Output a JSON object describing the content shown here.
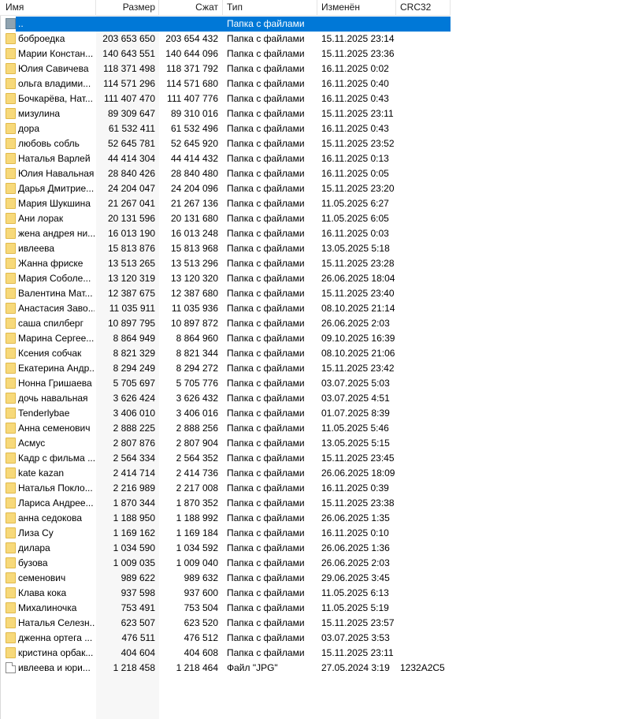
{
  "columns": {
    "name": "Имя",
    "size": "Размер",
    "compressed": "Сжат",
    "type": "Тип",
    "modified": "Изменён",
    "crc": "CRC32"
  },
  "parent_row": {
    "name": "..",
    "type": "Папка с файлами",
    "icon": "parent-folder-icon"
  },
  "rows": [
    {
      "name": "боброедка",
      "size": "203 653 650",
      "compressed": "203 654 432",
      "type": "Папка с файлами",
      "modified": "15.11.2025 23:14",
      "crc": "",
      "icon": "folder-icon"
    },
    {
      "name": "Марии Констан...",
      "size": "140 643 551",
      "compressed": "140 644 096",
      "type": "Папка с файлами",
      "modified": "15.11.2025 23:36",
      "crc": "",
      "icon": "folder-icon"
    },
    {
      "name": "Юлия Савичева",
      "size": "118 371 498",
      "compressed": "118 371 792",
      "type": "Папка с файлами",
      "modified": "16.11.2025 0:02",
      "crc": "",
      "icon": "folder-icon"
    },
    {
      "name": "ольга владими...",
      "size": "114 571 296",
      "compressed": "114 571 680",
      "type": "Папка с файлами",
      "modified": "16.11.2025 0:40",
      "crc": "",
      "icon": "folder-icon"
    },
    {
      "name": "Бочкарёва, Нат...",
      "size": "111 407 470",
      "compressed": "111 407 776",
      "type": "Папка с файлами",
      "modified": "16.11.2025 0:43",
      "crc": "",
      "icon": "folder-icon"
    },
    {
      "name": "мизулина",
      "size": "89 309 647",
      "compressed": "89 310 016",
      "type": "Папка с файлами",
      "modified": "15.11.2025 23:11",
      "crc": "",
      "icon": "folder-icon"
    },
    {
      "name": "дора",
      "size": "61 532 411",
      "compressed": "61 532 496",
      "type": "Папка с файлами",
      "modified": "16.11.2025 0:43",
      "crc": "",
      "icon": "folder-icon"
    },
    {
      "name": "любовь собль",
      "size": "52 645 781",
      "compressed": "52 645 920",
      "type": "Папка с файлами",
      "modified": "15.11.2025 23:52",
      "crc": "",
      "icon": "folder-icon"
    },
    {
      "name": "Наталья Варлей",
      "size": "44 414 304",
      "compressed": "44 414 432",
      "type": "Папка с файлами",
      "modified": "16.11.2025 0:13",
      "crc": "",
      "icon": "folder-icon"
    },
    {
      "name": "Юлия Навальная",
      "size": "28 840 426",
      "compressed": "28 840 480",
      "type": "Папка с файлами",
      "modified": "16.11.2025 0:05",
      "crc": "",
      "icon": "folder-icon"
    },
    {
      "name": "Дарья Дмитрие...",
      "size": "24 204 047",
      "compressed": "24 204 096",
      "type": "Папка с файлами",
      "modified": "15.11.2025 23:20",
      "crc": "",
      "icon": "folder-icon"
    },
    {
      "name": "Мария Шукшина",
      "size": "21 267 041",
      "compressed": "21 267 136",
      "type": "Папка с файлами",
      "modified": "11.05.2025 6:27",
      "crc": "",
      "icon": "folder-icon"
    },
    {
      "name": "Ани лорак",
      "size": "20 131 596",
      "compressed": "20 131 680",
      "type": "Папка с файлами",
      "modified": "11.05.2025 6:05",
      "crc": "",
      "icon": "folder-icon"
    },
    {
      "name": "жена андрея ни...",
      "size": "16 013 190",
      "compressed": "16 013 248",
      "type": "Папка с файлами",
      "modified": "16.11.2025 0:03",
      "crc": "",
      "icon": "folder-icon"
    },
    {
      "name": "ивлеева",
      "size": "15 813 876",
      "compressed": "15 813 968",
      "type": "Папка с файлами",
      "modified": "13.05.2025 5:18",
      "crc": "",
      "icon": "folder-icon"
    },
    {
      "name": "Жанна фриске",
      "size": "13 513 265",
      "compressed": "13 513 296",
      "type": "Папка с файлами",
      "modified": "15.11.2025 23:28",
      "crc": "",
      "icon": "folder-icon"
    },
    {
      "name": "Мария Соболе...",
      "size": "13 120 319",
      "compressed": "13 120 320",
      "type": "Папка с файлами",
      "modified": "26.06.2025 18:04",
      "crc": "",
      "icon": "folder-icon"
    },
    {
      "name": "Валентина Мат...",
      "size": "12 387 675",
      "compressed": "12 387 680",
      "type": "Папка с файлами",
      "modified": "15.11.2025 23:40",
      "crc": "",
      "icon": "folder-icon"
    },
    {
      "name": "Анастасия Заво...",
      "size": "11 035 911",
      "compressed": "11 035 936",
      "type": "Папка с файлами",
      "modified": "08.10.2025 21:14",
      "crc": "",
      "icon": "folder-icon"
    },
    {
      "name": "саша спилберг",
      "size": "10 897 795",
      "compressed": "10 897 872",
      "type": "Папка с файлами",
      "modified": "26.06.2025 2:03",
      "crc": "",
      "icon": "folder-icon"
    },
    {
      "name": "Марина Сергее...",
      "size": "8 864 949",
      "compressed": "8 864 960",
      "type": "Папка с файлами",
      "modified": "09.10.2025 16:39",
      "crc": "",
      "icon": "folder-icon"
    },
    {
      "name": "Ксения собчак",
      "size": "8 821 329",
      "compressed": "8 821 344",
      "type": "Папка с файлами",
      "modified": "08.10.2025 21:06",
      "crc": "",
      "icon": "folder-icon"
    },
    {
      "name": "Екатерина Андр...",
      "size": "8 294 249",
      "compressed": "8 294 272",
      "type": "Папка с файлами",
      "modified": "15.11.2025 23:42",
      "crc": "",
      "icon": "folder-icon"
    },
    {
      "name": "Нонна Гришаева",
      "size": "5 705 697",
      "compressed": "5 705 776",
      "type": "Папка с файлами",
      "modified": "03.07.2025 5:03",
      "crc": "",
      "icon": "folder-icon"
    },
    {
      "name": "дочь навальная",
      "size": "3 626 424",
      "compressed": "3 626 432",
      "type": "Папка с файлами",
      "modified": "03.07.2025 4:51",
      "crc": "",
      "icon": "folder-icon"
    },
    {
      "name": "Tenderlybae",
      "size": "3 406 010",
      "compressed": "3 406 016",
      "type": "Папка с файлами",
      "modified": "01.07.2025 8:39",
      "crc": "",
      "icon": "folder-icon"
    },
    {
      "name": "Анна семенович",
      "size": "2 888 225",
      "compressed": "2 888 256",
      "type": "Папка с файлами",
      "modified": "11.05.2025 5:46",
      "crc": "",
      "icon": "folder-icon"
    },
    {
      "name": "Асмус",
      "size": "2 807 876",
      "compressed": "2 807 904",
      "type": "Папка с файлами",
      "modified": "13.05.2025 5:15",
      "crc": "",
      "icon": "folder-icon"
    },
    {
      "name": "Кадр с фильма ...",
      "size": "2 564 334",
      "compressed": "2 564 352",
      "type": "Папка с файлами",
      "modified": "15.11.2025 23:45",
      "crc": "",
      "icon": "folder-icon"
    },
    {
      "name": "kate kazan",
      "size": "2 414 714",
      "compressed": "2 414 736",
      "type": "Папка с файлами",
      "modified": "26.06.2025 18:09",
      "crc": "",
      "icon": "folder-icon"
    },
    {
      "name": "Наталья Покло...",
      "size": "2 216 989",
      "compressed": "2 217 008",
      "type": "Папка с файлами",
      "modified": "16.11.2025 0:39",
      "crc": "",
      "icon": "folder-icon"
    },
    {
      "name": "Лариса Андрее...",
      "size": "1 870 344",
      "compressed": "1 870 352",
      "type": "Папка с файлами",
      "modified": "15.11.2025 23:38",
      "crc": "",
      "icon": "folder-icon"
    },
    {
      "name": "анна седокова",
      "size": "1 188 950",
      "compressed": "1 188 992",
      "type": "Папка с файлами",
      "modified": "26.06.2025 1:35",
      "crc": "",
      "icon": "folder-icon"
    },
    {
      "name": "Лиза Су",
      "size": "1 169 162",
      "compressed": "1 169 184",
      "type": "Папка с файлами",
      "modified": "16.11.2025 0:10",
      "crc": "",
      "icon": "folder-icon"
    },
    {
      "name": "дилара",
      "size": "1 034 590",
      "compressed": "1 034 592",
      "type": "Папка с файлами",
      "modified": "26.06.2025 1:36",
      "crc": "",
      "icon": "folder-icon"
    },
    {
      "name": "бузова",
      "size": "1 009 035",
      "compressed": "1 009 040",
      "type": "Папка с файлами",
      "modified": "26.06.2025 2:03",
      "crc": "",
      "icon": "folder-icon"
    },
    {
      "name": "семенович",
      "size": "989 622",
      "compressed": "989 632",
      "type": "Папка с файлами",
      "modified": "29.06.2025 3:45",
      "crc": "",
      "icon": "folder-icon"
    },
    {
      "name": "Клава кока",
      "size": "937 598",
      "compressed": "937 600",
      "type": "Папка с файлами",
      "modified": "11.05.2025 6:13",
      "crc": "",
      "icon": "folder-icon"
    },
    {
      "name": "Михалиночка",
      "size": "753 491",
      "compressed": "753 504",
      "type": "Папка с файлами",
      "modified": "11.05.2025 5:19",
      "crc": "",
      "icon": "folder-icon"
    },
    {
      "name": "Наталья Селезн...",
      "size": "623 507",
      "compressed": "623 520",
      "type": "Папка с файлами",
      "modified": "15.11.2025 23:57",
      "crc": "",
      "icon": "folder-icon"
    },
    {
      "name": "дженна ортега ...",
      "size": "476 511",
      "compressed": "476 512",
      "type": "Папка с файлами",
      "modified": "03.07.2025 3:53",
      "crc": "",
      "icon": "folder-icon"
    },
    {
      "name": "кристина орбак...",
      "size": "404 604",
      "compressed": "404 608",
      "type": "Папка с файлами",
      "modified": "15.11.2025 23:11",
      "crc": "",
      "icon": "folder-icon"
    },
    {
      "name": "ивлеева и юри...",
      "size": "1 218 458",
      "compressed": "1 218 464",
      "type": "Файл \"JPG\"",
      "modified": "27.05.2024 3:19",
      "crc": "1232A2C5",
      "icon": "file-icon"
    }
  ],
  "colors": {
    "selection": "#0078d7",
    "folder": "#f7d97a",
    "sorted_column": "#f7f7f7"
  }
}
